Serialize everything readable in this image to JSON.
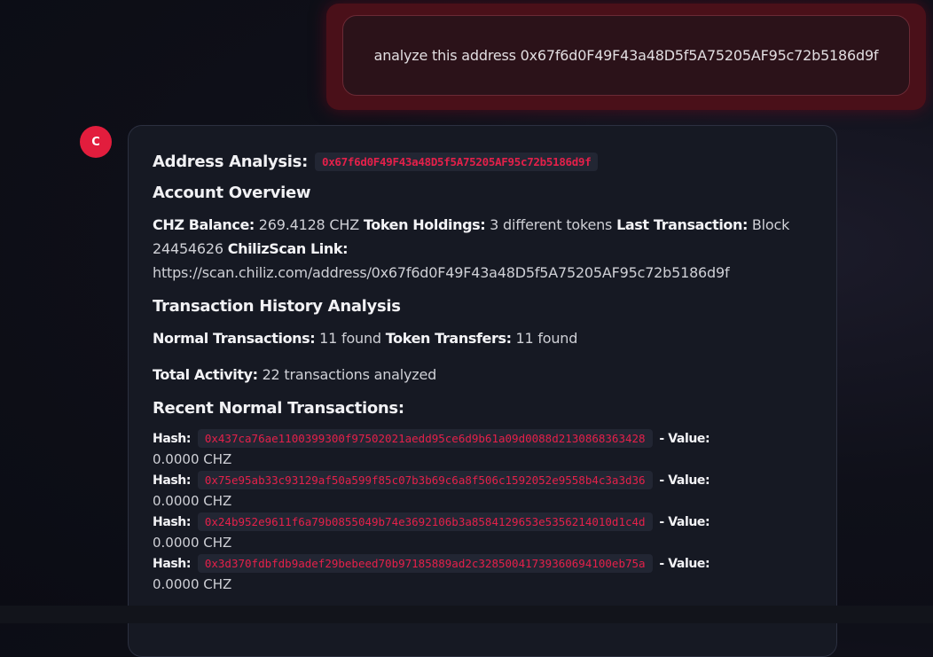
{
  "user_message": "analyze this address 0x67f6d0F49F43a48D5f5A75205AF95c72b5186d9f",
  "assistant": {
    "avatar_letter": "C",
    "heading_label": "Address Analysis:",
    "heading_address": "0x67f6d0F49F43a48D5f5A75205AF95c72b5186d9f",
    "overview": {
      "title": "Account Overview",
      "balance_label": "CHZ Balance:",
      "balance_value": "269.4128 CHZ",
      "holdings_label": "Token Holdings:",
      "holdings_value": "3 different tokens",
      "last_tx_label": "Last Transaction:",
      "last_tx_value": "Block 24454626",
      "link_label": "ChilizScan Link:",
      "link_value": "https://scan.chiliz.com/address/0x67f6d0F49F43a48D5f5A75205AF95c72b5186d9f"
    },
    "history": {
      "title": "Transaction History Analysis",
      "normal_label": "Normal Transactions:",
      "normal_value": "11 found",
      "token_label": "Token Transfers:",
      "token_value": "11 found",
      "activity_label": "Total Activity:",
      "activity_value": "22 transactions analyzed"
    },
    "recent": {
      "title": "Recent Normal Transactions:",
      "hash_label": "Hash:",
      "value_label": "- Value:",
      "transactions": [
        {
          "hash": "0x437ca76ae1100399300f97502021aedd95ce6d9b61a09d0088d2130868363428",
          "value": "0.0000 CHZ"
        },
        {
          "hash": "0x75e95ab33c93129af50a599f85c07b3b69c6a8f506c1592052e9558b4c3a3d36",
          "value": "0.0000 CHZ"
        },
        {
          "hash": "0x24b952e9611f6a79b0855049b74e3692106b3a8584129653e5356214010d1c4d",
          "value": "0.0000 CHZ"
        },
        {
          "hash": "0x3d370fdbfdb9adef29bebeed70b97185889ad2c32850041739360694100eb75a",
          "value": "0.0000 CHZ"
        }
      ]
    }
  }
}
